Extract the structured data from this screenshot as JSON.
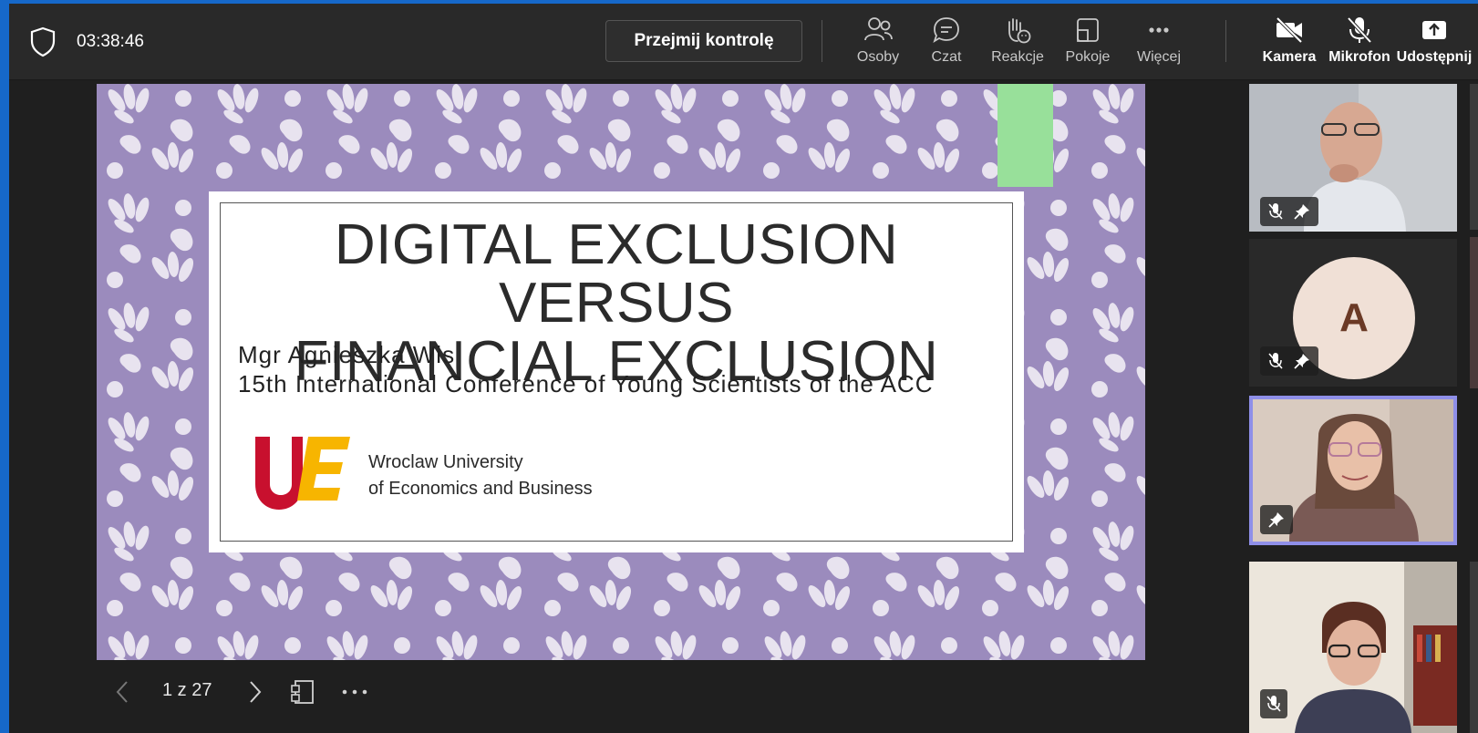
{
  "topbar": {
    "timer": "03:38:46",
    "take_control_label": "Przejmij kontrolę",
    "tools": [
      {
        "label": "Osoby",
        "icon": "people-icon"
      },
      {
        "label": "Czat",
        "icon": "chat-icon"
      },
      {
        "label": "Reakcje",
        "icon": "raise-hand-icon"
      },
      {
        "label": "Pokoje",
        "icon": "rooms-icon"
      },
      {
        "label": "Więcej",
        "icon": "more-icon"
      }
    ],
    "actions": [
      {
        "label": "Kamera",
        "icon": "camera-off-icon"
      },
      {
        "label": "Mikrofon",
        "icon": "mic-off-icon"
      },
      {
        "label": "Udostępnij",
        "icon": "share-icon"
      }
    ]
  },
  "slide": {
    "title_line1": "DIGITAL EXCLUSION VERSUS",
    "title_line2": "FINANCIAL EXCLUSION",
    "author": "Mgr Agnieszka Wis",
    "conference": "15th International Conference of Young Scientists of the ACC",
    "logo_text": "UE",
    "university_line1": "Wroclaw University",
    "university_line2": "of Economics and Business",
    "colors": {
      "background": "#9b8bbd",
      "pattern": "#e8e3ef",
      "logo_red": "#c8102e",
      "logo_yellow": "#f7b500"
    }
  },
  "slide_controls": {
    "page_info": "1 z 27"
  },
  "participants": [
    {
      "type": "video",
      "muted": true,
      "pinned": true,
      "active": false
    },
    {
      "type": "avatar",
      "initial": "A",
      "muted": true,
      "pinned": true,
      "active": false
    },
    {
      "type": "video",
      "muted": false,
      "pinned": true,
      "active": true
    },
    {
      "type": "video",
      "muted": true,
      "pinned": false,
      "active": false
    }
  ]
}
